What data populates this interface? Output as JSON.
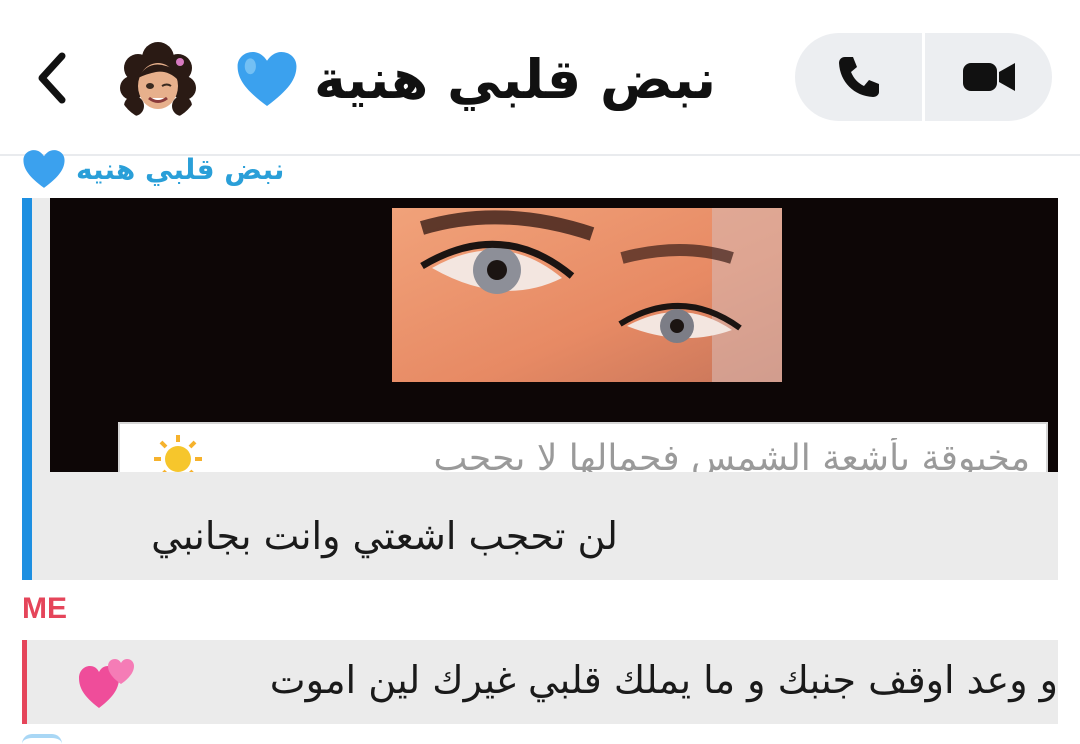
{
  "header": {
    "back_icon": "chevron-left-icon",
    "avatar": "bitmoji-avatar",
    "title": "نبض قلبي هنية",
    "title_emoji": "blue-heart-icon",
    "call_icon": "phone-icon",
    "video_icon": "video-camera-icon"
  },
  "quoted_message": {
    "author": "نبض قلبي هنيه",
    "author_emoji": "blue-heart-icon",
    "image_caption": "مخيوقة بأشعة الشمس فجمالها لا يحجب",
    "image_emoji": "sun-icon",
    "text": "لن تحجب اشعتي وانت بجانبي",
    "accent_color": "#1d8fe1"
  },
  "my_message": {
    "sender_label": "ME",
    "text": "و وعد اوقف جنبك و ما يملك قلبي غيرك لين اموت",
    "emoji": "two-hearts-icon",
    "accent_color": "#e5455a"
  }
}
